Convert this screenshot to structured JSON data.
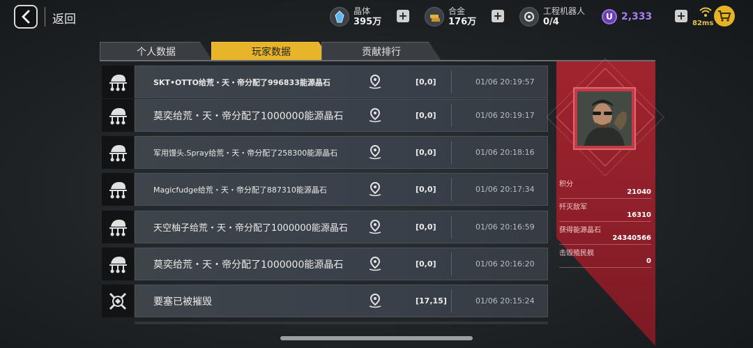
{
  "topbar": {
    "back_label": "返回",
    "crystal": {
      "label": "晶体",
      "value": "395万",
      "icon": "crystal-icon"
    },
    "alloy": {
      "label": "合金",
      "value": "176万",
      "icon": "alloy-icon"
    },
    "robot": {
      "label": "工程机器人",
      "value": "0/4",
      "icon": "robot-icon"
    },
    "u_currency": {
      "symbol": "U",
      "value": "2,333",
      "color": "#a77ff0"
    },
    "ping": "82ms",
    "plus_symbol": "+"
  },
  "tabs": [
    {
      "label": "个人数据",
      "active": false
    },
    {
      "label": "玩家数据",
      "active": true
    },
    {
      "label": "贡献排行",
      "active": false
    }
  ],
  "feed": [
    {
      "icon": "alliance-icon",
      "text": "SKT•OTTO给荒・天・帝分配了996833能源晶石",
      "coord": "[0,0]",
      "time": "01/06 20:19:57"
    },
    {
      "icon": "alliance-icon",
      "text": "莫奕给荒・天・帝分配了1000000能源晶石",
      "coord": "[0,0]",
      "time": "01/06 20:19:17"
    },
    {
      "icon": "alliance-icon",
      "text": "军用馒头.Spray给荒・天・帝分配了258300能源晶石",
      "coord": "[0,0]",
      "time": "01/06 20:18:16"
    },
    {
      "icon": "alliance-icon",
      "text": "Magicfudge给荒・天・帝分配了887310能源晶石",
      "coord": "[0,0]",
      "time": "01/06 20:17:34"
    },
    {
      "icon": "alliance-icon",
      "text": "天空柚子给荒・天・帝分配了1000000能源晶石",
      "coord": "[0,0]",
      "time": "01/06 20:16:59"
    },
    {
      "icon": "alliance-icon",
      "text": "莫奕给荒・天・帝分配了1000000能源晶石",
      "coord": "[0,0]",
      "time": "01/06 20:16:20"
    },
    {
      "icon": "crossed-swords-icon",
      "text": "要塞已被摧毁",
      "coord": "[17,15]",
      "time": "01/06 20:15:24"
    }
  ],
  "stats": [
    {
      "label": "积分",
      "value": "21040"
    },
    {
      "label": "歼灭敌军",
      "value": "16310"
    },
    {
      "label": "获得能源晶石",
      "value": "24340566"
    },
    {
      "label": "击毁殖民舰",
      "value": "0"
    }
  ],
  "colors": {
    "accent_tab": "#e8b52a",
    "panel_red": "#a0242f"
  }
}
